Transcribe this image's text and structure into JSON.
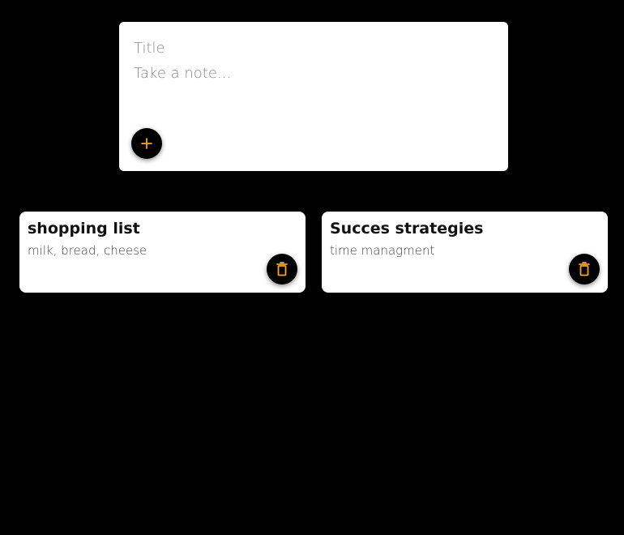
{
  "composer": {
    "title_placeholder": "Title",
    "content_placeholder": "Take a note...",
    "add_icon": "plus-icon"
  },
  "notes": [
    {
      "title": "shopping list",
      "content": "milk, bread, cheese",
      "delete_icon": "trash-icon"
    },
    {
      "title": "Succes strategies",
      "content": "time managment",
      "delete_icon": "trash-icon"
    }
  ],
  "colors": {
    "background": "#000000",
    "card": "#ffffff",
    "accent": "#f5a623"
  }
}
